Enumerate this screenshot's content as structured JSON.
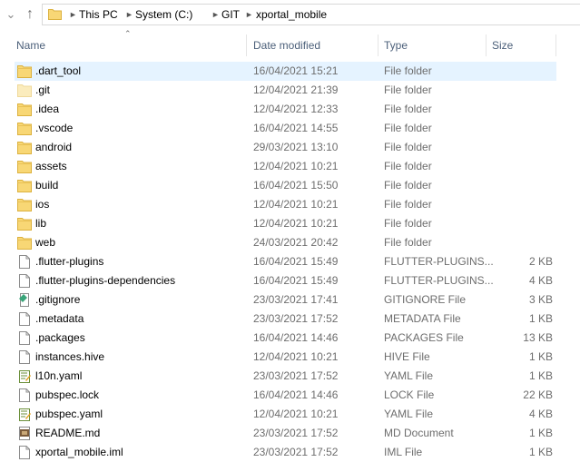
{
  "address": {
    "breadcrumbs": [
      "This PC",
      "System (C:)",
      "GIT",
      "xportal_mobile"
    ]
  },
  "columns": {
    "name": "Name",
    "date": "Date modified",
    "type": "Type",
    "size": "Size"
  },
  "files": [
    {
      "name": ".dart_tool",
      "date": "16/04/2021 15:21",
      "type": "File folder",
      "size": "",
      "icon": "folder-icon",
      "selected": true
    },
    {
      "name": ".git",
      "date": "12/04/2021 21:39",
      "type": "File folder",
      "size": "",
      "icon": "hidden-folder-icon"
    },
    {
      "name": ".idea",
      "date": "12/04/2021 12:33",
      "type": "File folder",
      "size": "",
      "icon": "folder-icon"
    },
    {
      "name": ".vscode",
      "date": "16/04/2021 14:55",
      "type": "File folder",
      "size": "",
      "icon": "folder-icon"
    },
    {
      "name": "android",
      "date": "29/03/2021 13:10",
      "type": "File folder",
      "size": "",
      "icon": "folder-icon"
    },
    {
      "name": "assets",
      "date": "12/04/2021 10:21",
      "type": "File folder",
      "size": "",
      "icon": "folder-icon"
    },
    {
      "name": "build",
      "date": "16/04/2021 15:50",
      "type": "File folder",
      "size": "",
      "icon": "folder-icon"
    },
    {
      "name": "ios",
      "date": "12/04/2021 10:21",
      "type": "File folder",
      "size": "",
      "icon": "folder-icon"
    },
    {
      "name": "lib",
      "date": "12/04/2021 10:21",
      "type": "File folder",
      "size": "",
      "icon": "folder-icon"
    },
    {
      "name": "web",
      "date": "24/03/2021 20:42",
      "type": "File folder",
      "size": "",
      "icon": "folder-icon"
    },
    {
      "name": ".flutter-plugins",
      "date": "16/04/2021 15:49",
      "type": "FLUTTER-PLUGINS...",
      "size": "2 KB",
      "icon": "file-icon"
    },
    {
      "name": ".flutter-plugins-dependencies",
      "date": "16/04/2021 15:49",
      "type": "FLUTTER-PLUGINS...",
      "size": "4 KB",
      "icon": "file-icon"
    },
    {
      "name": ".gitignore",
      "date": "23/03/2021 17:41",
      "type": "GITIGNORE File",
      "size": "3 KB",
      "icon": "gitignore-file-icon"
    },
    {
      "name": ".metadata",
      "date": "23/03/2021 17:52",
      "type": "METADATA File",
      "size": "1 KB",
      "icon": "file-icon"
    },
    {
      "name": ".packages",
      "date": "16/04/2021 14:46",
      "type": "PACKAGES File",
      "size": "13 KB",
      "icon": "file-icon"
    },
    {
      "name": "instances.hive",
      "date": "12/04/2021 10:21",
      "type": "HIVE File",
      "size": "1 KB",
      "icon": "file-icon"
    },
    {
      "name": "l10n.yaml",
      "date": "23/03/2021 17:52",
      "type": "YAML File",
      "size": "1 KB",
      "icon": "yaml-file-icon"
    },
    {
      "name": "pubspec.lock",
      "date": "16/04/2021 14:46",
      "type": "LOCK File",
      "size": "22 KB",
      "icon": "file-icon"
    },
    {
      "name": "pubspec.yaml",
      "date": "12/04/2021 10:21",
      "type": "YAML File",
      "size": "4 KB",
      "icon": "yaml-file-icon"
    },
    {
      "name": "README.md",
      "date": "23/03/2021 17:52",
      "type": "MD Document",
      "size": "1 KB",
      "icon": "md-file-icon"
    },
    {
      "name": "xportal_mobile.iml",
      "date": "23/03/2021 17:52",
      "type": "IML File",
      "size": "1 KB",
      "icon": "file-icon"
    }
  ]
}
